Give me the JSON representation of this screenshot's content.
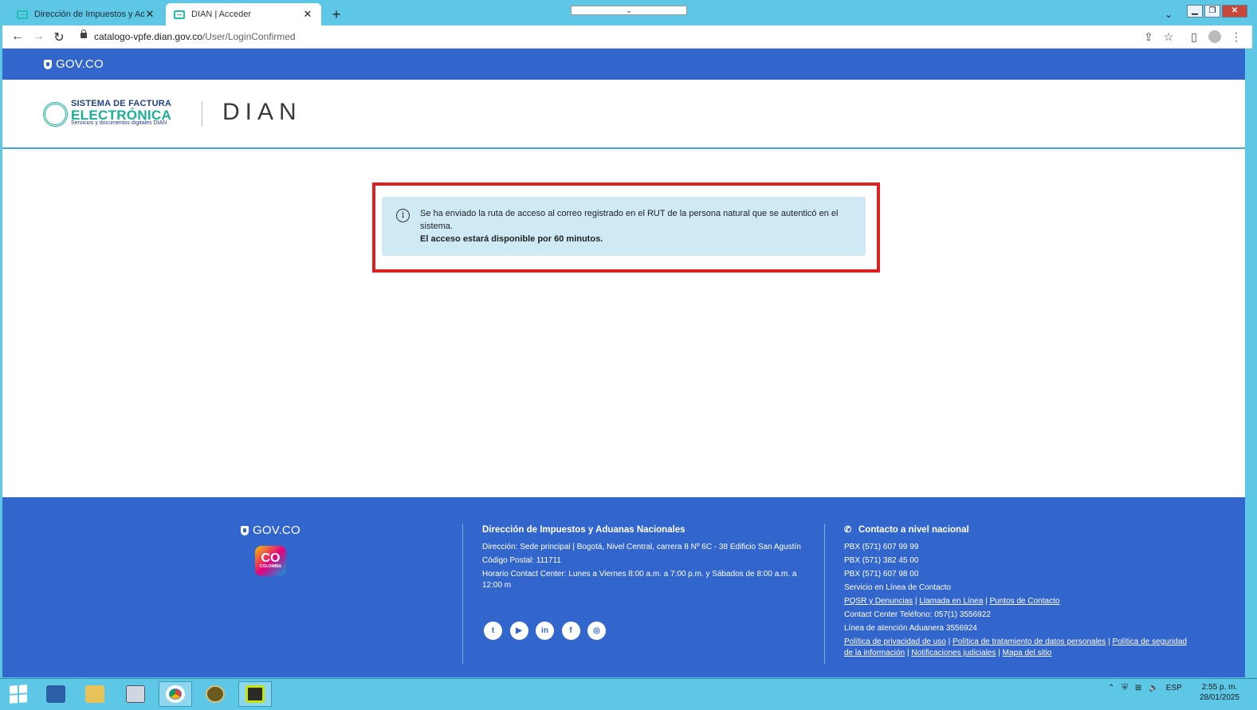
{
  "browser": {
    "tabs": [
      {
        "title": "Dirección de Impuestos y Aduanas",
        "active": false
      },
      {
        "title": "DIAN | Acceder",
        "active": true
      }
    ],
    "new_tab": "+",
    "tab_close": "✕",
    "url_host": "catalogo-vpfe.dian.gov.co",
    "url_path": "/User/LoginConfirmed"
  },
  "gov_bar": {
    "logo_text": "GOV.CO"
  },
  "brand": {
    "sfe_line1": "SISTEMA DE FACTURA",
    "sfe_line2": "ELECTRÓNICA",
    "sfe_line3": "Servicios y documentos digitales DIAN",
    "dian": "DIAN"
  },
  "alert": {
    "icon": "info-icon",
    "message": "Se ha enviado la ruta de acceso al correo registrado en el RUT de la persona natural que se autenticó en el sistema.",
    "bold_message": "El acceso estará disponible por 60 minutos."
  },
  "footer": {
    "gov_logo": "GOV.CO",
    "co_logo": {
      "big": "CO",
      "small": "COLOMBIA"
    },
    "col1": {
      "title": "Dirección de Impuestos y Aduanas Nacionales",
      "address": "Dirección: Sede principal | Bogotá, Nivel Central, carrera 8 Nº 6C - 38 Edificio San Agustín",
      "postal": "Código Postal: 111711",
      "hours": "Horario Contact Center: Lunes a Viernes 8:00 a.m. a 7:00 p.m. y Sábados de 8:00 a.m. a 12:00 m"
    },
    "socials": [
      "twitter",
      "youtube",
      "linkedin",
      "facebook",
      "instagram"
    ],
    "col2": {
      "title": "Contacto a nivel nacional",
      "pbx1": "PBX (571) 607 99 99",
      "pbx2": "PBX (571) 382 45 00",
      "pbx3": "PBX (571) 607 98 00",
      "online": "Servicio en Línea de Contacto",
      "link_pqsr": "PQSR y Denuncias",
      "link_llamada": "Llamada en Línea",
      "link_puntos": "Puntos de Contacto",
      "contact_center": "Contact Center Teléfono: 057(1) 3556922",
      "aduanera": "Línea de atención Aduanera 3556924",
      "link_privacidad": "Política de privacidad de uso",
      "link_tratamiento": "Política de tratamiento de datos personales",
      "link_seguridad": "Política de seguridad de la información",
      "link_notificaciones": "Notificaciones judiciales",
      "link_mapa": "Mapa del sitio",
      "separator": "|"
    }
  },
  "taskbar": {
    "lang": "ESP",
    "time": "2:55 p. m.",
    "date": "28/01/2025"
  }
}
